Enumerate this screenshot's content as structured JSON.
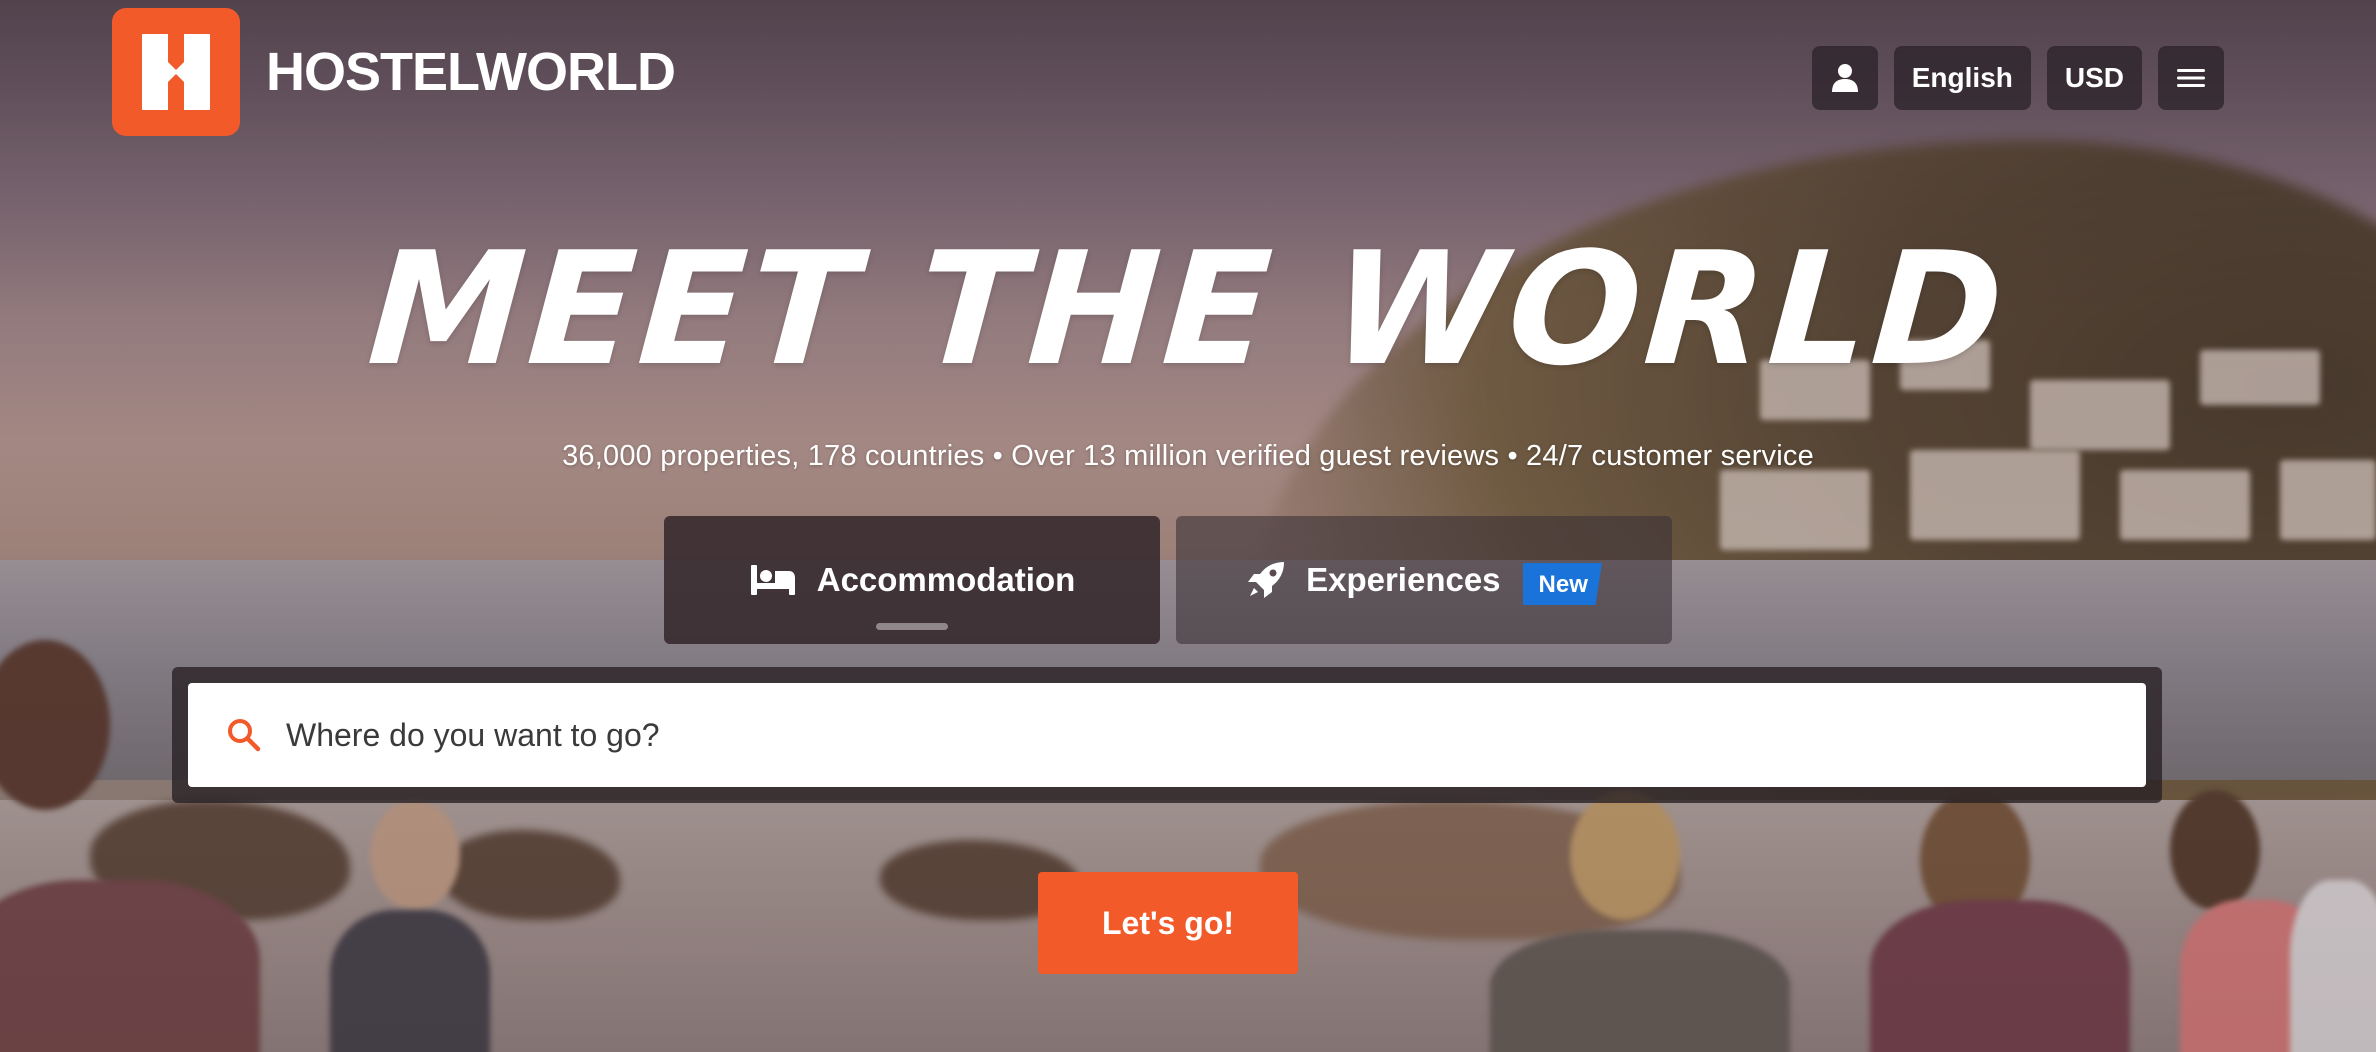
{
  "brand": {
    "name": "HOSTELWORLD",
    "accent_color": "#f25a29"
  },
  "header": {
    "account_icon": "user-icon",
    "language_label": "English",
    "currency_label": "USD",
    "menu_icon": "hamburger-menu-icon"
  },
  "hero": {
    "headline": "MEET THE WORLD",
    "tagline": "36,000 properties, 178 countries • Over 13 million verified guest reviews • 24/7 customer service"
  },
  "tabs": [
    {
      "label": "Accommodation",
      "icon": "bed-icon",
      "active": true
    },
    {
      "label": "Experiences",
      "icon": "rocket-icon",
      "active": false,
      "badge": "New",
      "badge_color": "#1a73d8"
    }
  ],
  "search": {
    "icon": "search-icon",
    "placeholder": "Where do you want to go?"
  },
  "cta": {
    "label": "Let's go!"
  }
}
